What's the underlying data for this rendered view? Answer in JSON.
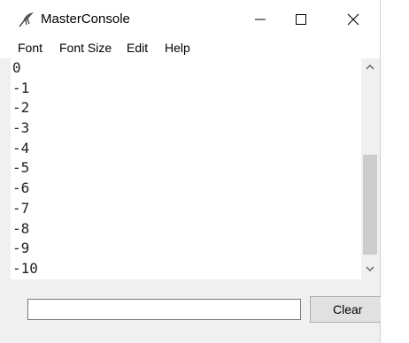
{
  "window": {
    "title": "MasterConsole",
    "controls": {
      "minimize_icon": "minimize-icon",
      "maximize_icon": "maximize-icon",
      "close_icon": "close-icon"
    }
  },
  "menubar": {
    "items": [
      "Font",
      "Font Size",
      "Edit",
      "Help"
    ]
  },
  "console": {
    "lines": [
      "0",
      "-1",
      "-2",
      "-3",
      "-4",
      "-5",
      "-6",
      "-7",
      "-8",
      "-9",
      "-10"
    ],
    "scroll_position": 0.67
  },
  "input_bar": {
    "value": "",
    "clear_label": "Clear"
  },
  "colors": {
    "window_bg": "#f0f0f0",
    "titlebar_bg": "#ffffff",
    "console_bg": "#ffffff",
    "console_text": "#222222",
    "scroll_thumb": "#cdcdcd"
  }
}
